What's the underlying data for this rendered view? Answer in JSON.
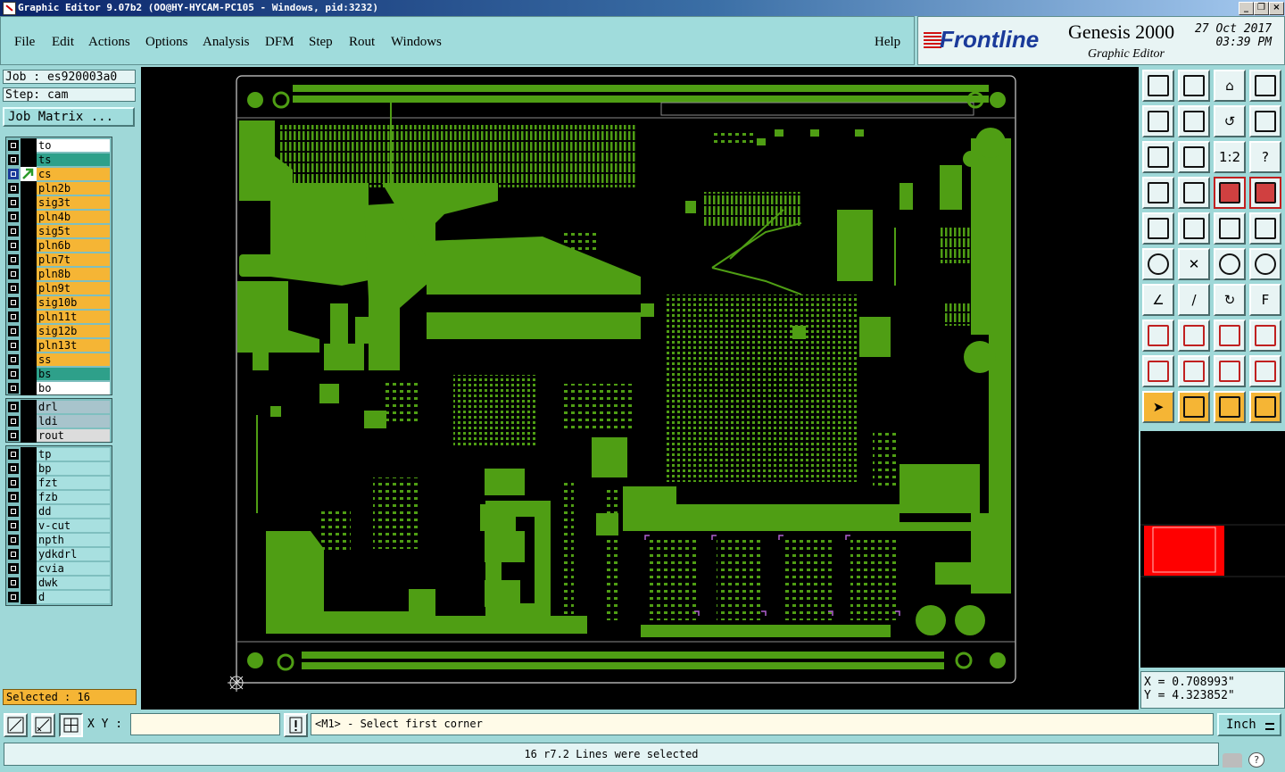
{
  "window": {
    "title": "Graphic Editor 9.07b2 (OO@HY-HYCAM-PC105 - Windows, pid:3232)",
    "controls": [
      "_",
      "❐",
      "×"
    ]
  },
  "menu": {
    "items": [
      "File",
      "Edit",
      "Actions",
      "Options",
      "Analysis",
      "DFM",
      "Step",
      "Rout",
      "Windows"
    ],
    "help": "Help"
  },
  "brand": {
    "logo": "Frontline",
    "product": "Genesis 2000",
    "subtitle": "Graphic Editor",
    "date": "27 Oct 2017",
    "time": "03:39 PM"
  },
  "job": {
    "job": "Job : es920003a0",
    "step": "Step: cam",
    "matrix_button": "Job Matrix ..."
  },
  "layers": {
    "board": [
      {
        "name": "to",
        "color": "white"
      },
      {
        "name": "ts",
        "color": "teal"
      },
      {
        "name": "cs",
        "color": "orange",
        "active": true
      },
      {
        "name": "pln2b",
        "color": "orange"
      },
      {
        "name": "sig3t",
        "color": "orange"
      },
      {
        "name": "pln4b",
        "color": "orange"
      },
      {
        "name": "sig5t",
        "color": "orange"
      },
      {
        "name": "pln6b",
        "color": "orange"
      },
      {
        "name": "pln7t",
        "color": "orange"
      },
      {
        "name": "pln8b",
        "color": "orange"
      },
      {
        "name": "pln9t",
        "color": "orange"
      },
      {
        "name": "sig10b",
        "color": "orange"
      },
      {
        "name": "pln11t",
        "color": "orange"
      },
      {
        "name": "sig12b",
        "color": "orange"
      },
      {
        "name": "pln13t",
        "color": "orange"
      },
      {
        "name": "ss",
        "color": "orange"
      },
      {
        "name": "bs",
        "color": "teal"
      },
      {
        "name": "bo",
        "color": "white"
      }
    ],
    "drill": [
      {
        "name": "drl",
        "color": "grey"
      },
      {
        "name": "ldi",
        "color": "grey"
      },
      {
        "name": "rout",
        "color": "lightgrey"
      }
    ],
    "misc": [
      {
        "name": "tp",
        "color": "cyan"
      },
      {
        "name": "bp",
        "color": "cyan"
      },
      {
        "name": "fzt",
        "color": "cyan"
      },
      {
        "name": "fzb",
        "color": "cyan"
      },
      {
        "name": "dd",
        "color": "cyan"
      },
      {
        "name": "v-cut",
        "color": "cyan"
      },
      {
        "name": "npth",
        "color": "cyan"
      },
      {
        "name": "ydkdrl",
        "color": "cyan"
      },
      {
        "name": "cvia",
        "color": "cyan"
      },
      {
        "name": "dwk",
        "color": "cyan"
      },
      {
        "name": "d",
        "color": "cyan"
      }
    ]
  },
  "selected": "Selected : 16",
  "coords": {
    "x": "X = 0.708993\"",
    "y": "Y = 4.323852\""
  },
  "bottom": {
    "xy_label": "X Y :",
    "xy_value": "",
    "prompt": "<M1> - Select first corner",
    "units": "Inch",
    "status": "16 r7.2 Lines were selected"
  },
  "colors": {
    "copper": "#4f9e14",
    "active_layer": "#f5b535",
    "preview_box": "#ff0000"
  }
}
